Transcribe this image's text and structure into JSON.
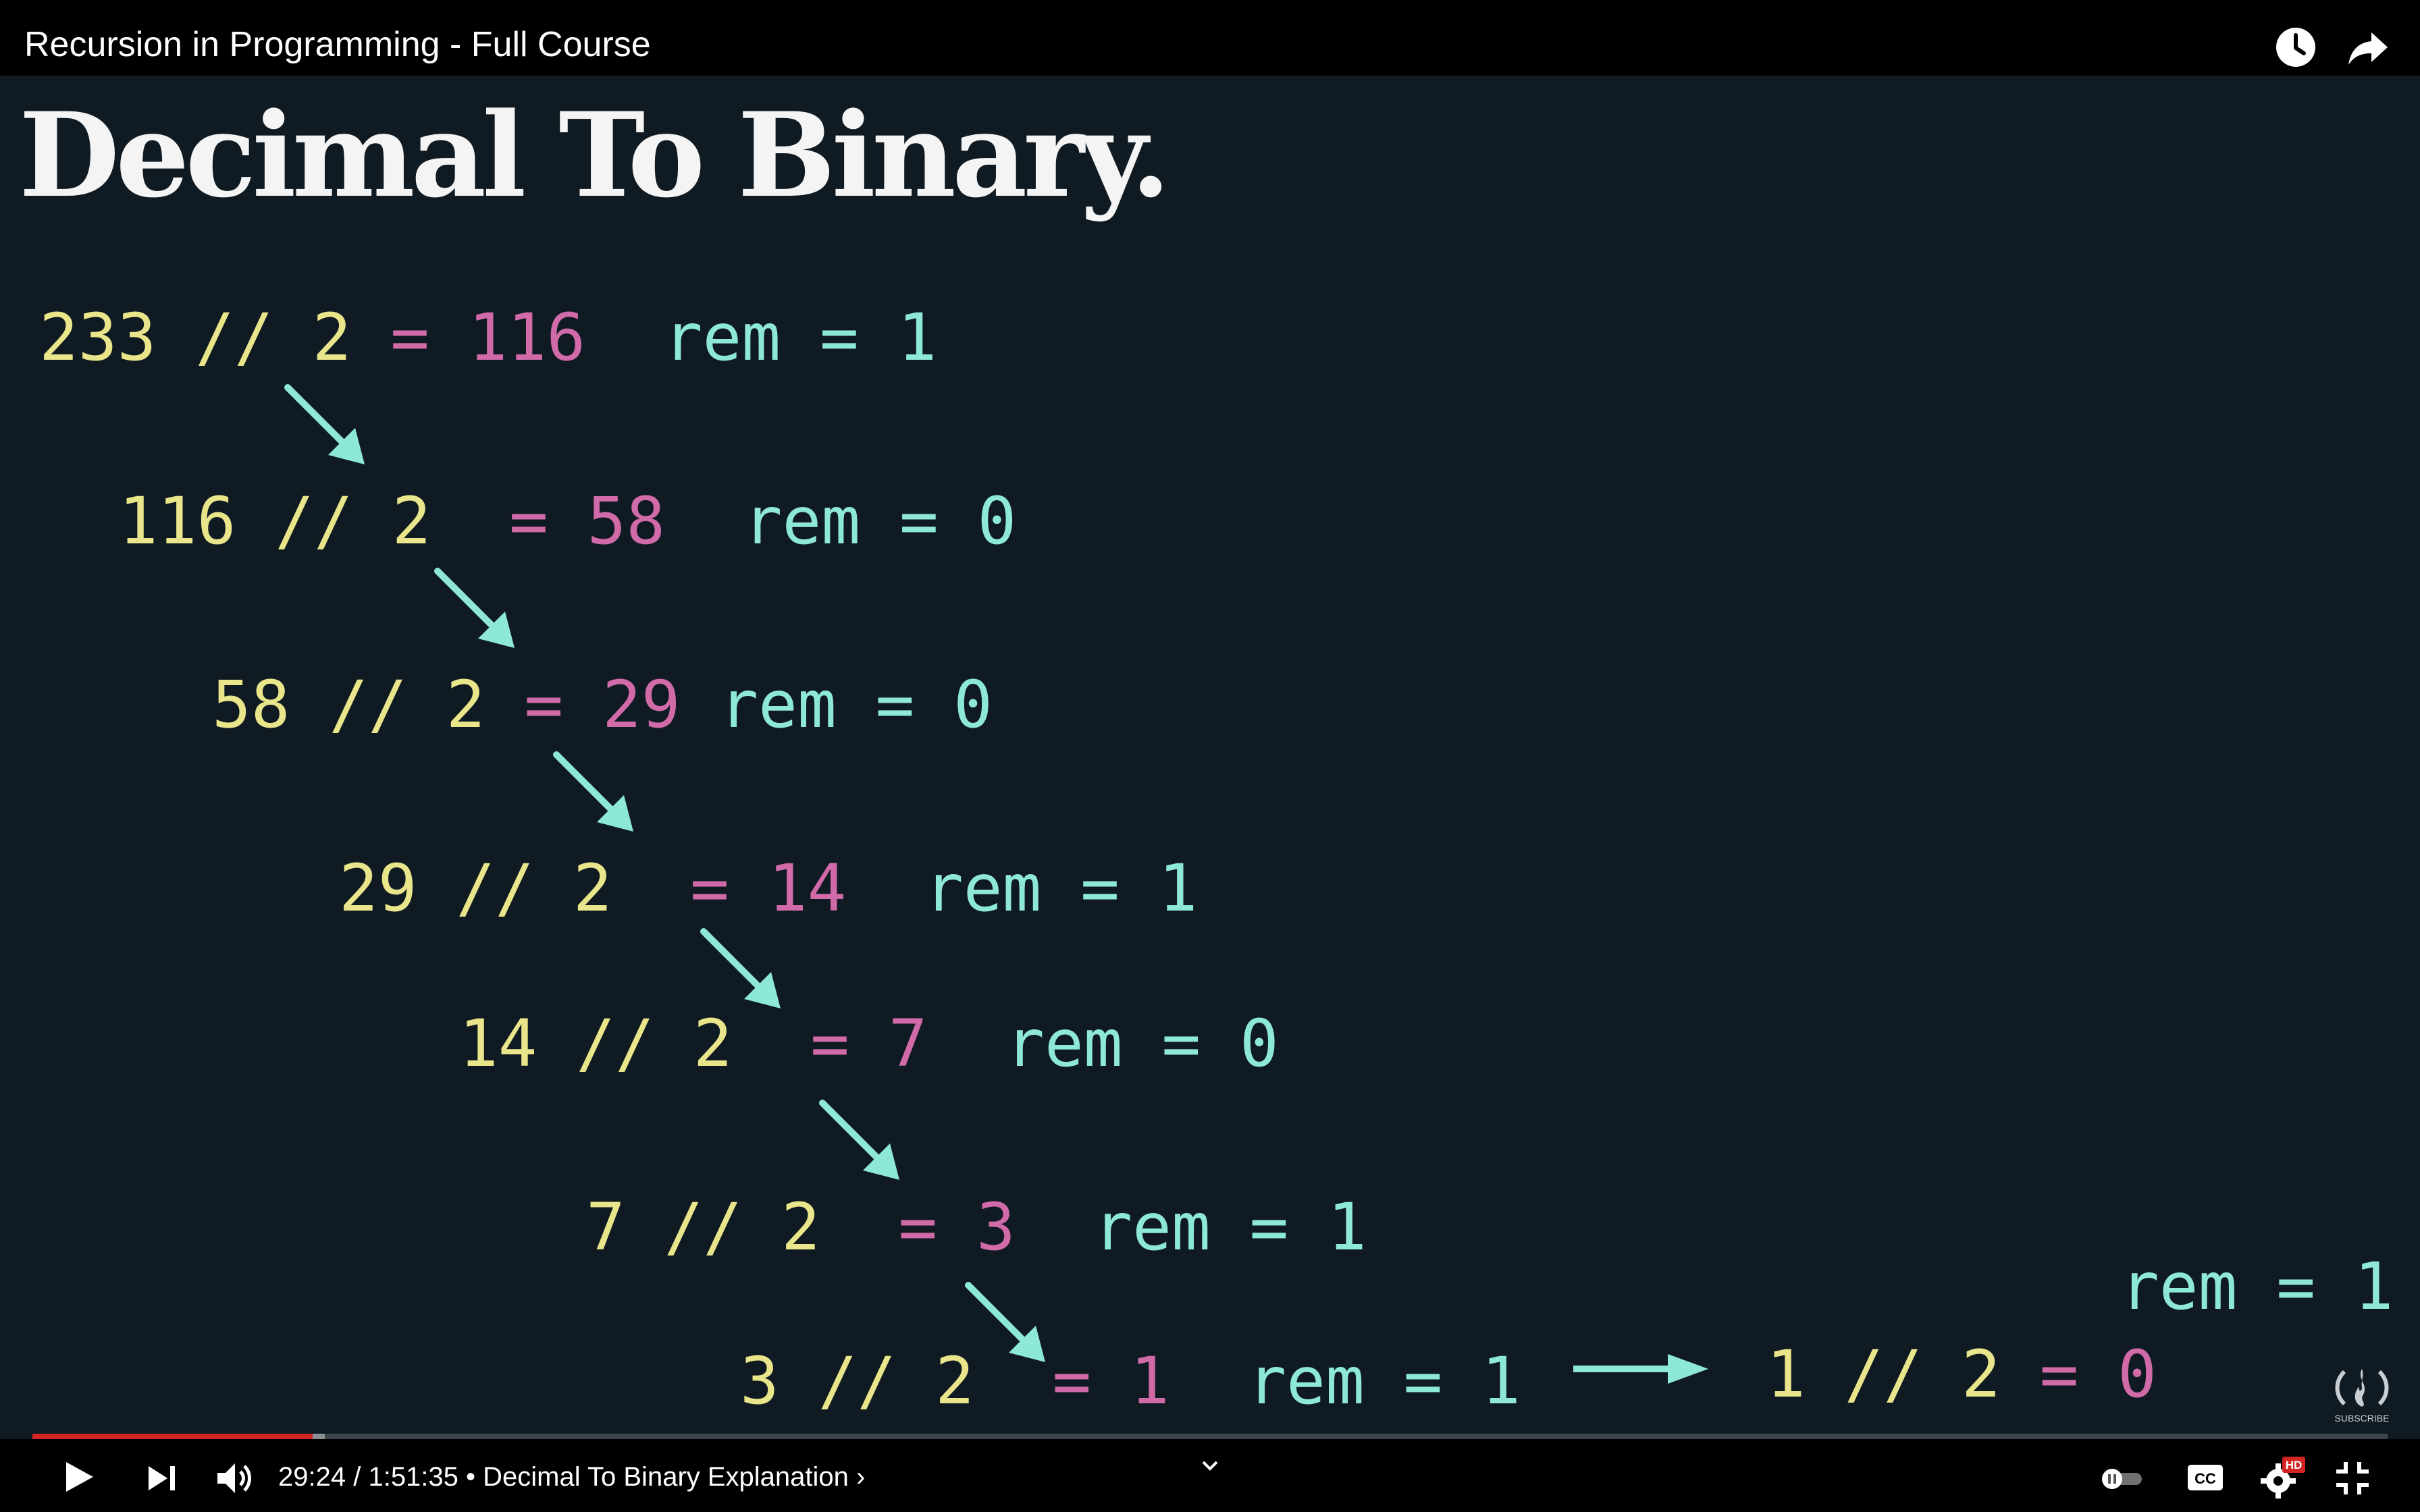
{
  "player": {
    "title": "Recursion in Programming - Full Course",
    "icons": {
      "watch_later": "clock-icon",
      "share": "share-arrow-icon",
      "play": "play-icon",
      "next": "skip-next-icon",
      "volume": "volume-icon",
      "chapters": "chevron-down-icon",
      "autoplay": "autoplay-toggle-icon",
      "captions": "cc-icon",
      "settings": "gear-icon",
      "exit_fullscreen": "exit-fullscreen-icon",
      "channel": "freecodecamp-logo-icon"
    },
    "current_time": "29:24",
    "duration": "1:51:35",
    "time_separator": " / ",
    "bullet": " • ",
    "chapter": "Decimal To Binary Explanation",
    "chapter_chevron": "›",
    "progress_played_fraction": 0.119,
    "progress_loaded_fraction": 0.124,
    "settings_badge": "HD",
    "captions_label": "CC",
    "logo_text": "SUBSCRIBE"
  },
  "slide": {
    "title": "Decimal To Binary.",
    "rows": [
      {
        "a": "233",
        "op": " // ",
        "b": "2",
        "eq": " = ",
        "q": "116",
        "rem": "  rem = 1"
      },
      {
        "a": "116",
        "op": " // ",
        "b": "2",
        "eq": "  = ",
        "q": "58",
        "rem": "  rem = 0"
      },
      {
        "a": "58",
        "op": " // ",
        "b": "2",
        "eq": " = ",
        "q": "29",
        "rem": " rem = 0"
      },
      {
        "a": "29",
        "op": " // ",
        "b": "2",
        "eq": "  = ",
        "q": "14",
        "rem": "  rem = 1"
      },
      {
        "a": "14",
        "op": " // ",
        "b": "2",
        "eq": "  = ",
        "q": "7",
        "rem": "  rem = 0"
      },
      {
        "a": "7",
        "op": " // ",
        "b": "2",
        "eq": "  = ",
        "q": "3",
        "rem": "  rem = 1"
      },
      {
        "a": "3",
        "op": " // ",
        "b": "2",
        "eq": "  = ",
        "q": "1",
        "rem": "  rem = 1"
      }
    ],
    "final_row": {
      "a": "1",
      "op": " // ",
      "b": "2",
      "eq": " = ",
      "q": "0"
    },
    "final_rem": "rem = 1"
  },
  "colors": {
    "operand": "#e9e58a",
    "quotient": "#d06aa8",
    "remainder": "#8ee8d6",
    "arrow": "#8ee8d6",
    "progress": "#d32424"
  }
}
